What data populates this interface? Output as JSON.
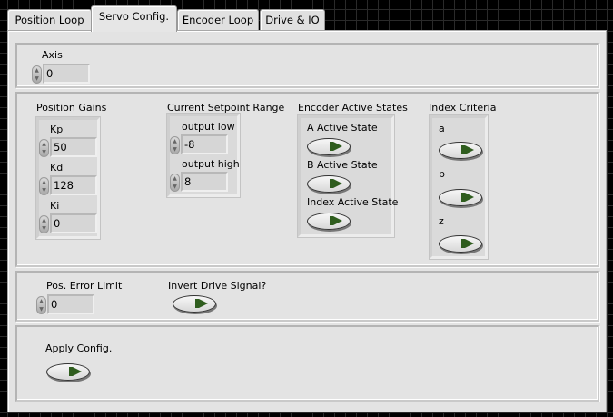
{
  "tabs": [
    {
      "label": "Position Loop"
    },
    {
      "label": "Servo Config.",
      "active": true
    },
    {
      "label": "Encoder Loop"
    },
    {
      "label": "Drive & IO"
    }
  ],
  "axis": {
    "label": "Axis",
    "value": "0"
  },
  "position_gains": {
    "title": "Position Gains",
    "kp_label": "Kp",
    "kp": "50",
    "kd_label": "Kd",
    "kd": "128",
    "ki_label": "Ki",
    "ki": "0"
  },
  "setpoint_range": {
    "title": "Current Setpoint Range",
    "low_label": "output low",
    "low": "-8",
    "high_label": "output high",
    "high": "8"
  },
  "encoder_states": {
    "title": "Encoder Active States",
    "a": "A Active State",
    "b": "B Active State",
    "index": "Index Active State"
  },
  "index_criteria": {
    "title": "Index Criteria",
    "a": "a",
    "b": "b",
    "z": "z"
  },
  "pos_error": {
    "label": "Pos. Error Limit",
    "value": "0"
  },
  "invert_drive": {
    "label": "Invert Drive Signal?"
  },
  "apply": {
    "label": "Apply Config."
  },
  "colors": {
    "led_off": "#2f5d1e",
    "panel": "#e3e3e3"
  }
}
